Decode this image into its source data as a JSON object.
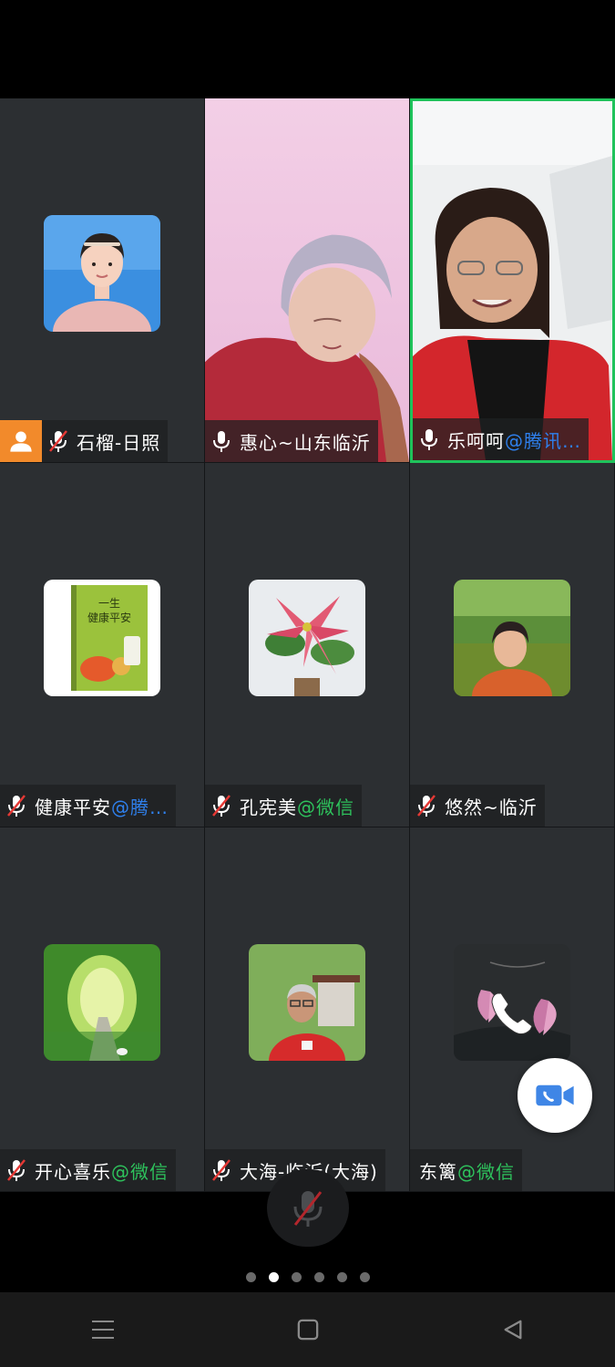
{
  "participants": [
    {
      "name": "石榴-日照",
      "suffix": "",
      "suffix_type": "",
      "mic": "muted",
      "host": true,
      "view": "avatar",
      "avatar": "portrait-blue-bg"
    },
    {
      "name": "惠心~山东临沂",
      "suffix": "",
      "suffix_type": "",
      "mic": "on",
      "host": false,
      "view": "video",
      "avatar": "video-woman-gray-hair"
    },
    {
      "name": "乐呵呵",
      "suffix": "@腾讯…",
      "suffix_type": "tencent",
      "mic": "on",
      "host": false,
      "view": "video",
      "avatar": "video-woman-glasses",
      "active": true
    },
    {
      "name": "健康平安",
      "suffix": "@腾…",
      "suffix_type": "tencent",
      "mic": "muted",
      "host": false,
      "view": "avatar",
      "avatar": "book-cover"
    },
    {
      "name": "孔宪美",
      "suffix": "@微信",
      "suffix_type": "wechat",
      "mic": "muted",
      "host": false,
      "view": "avatar",
      "avatar": "poinsettia-flower"
    },
    {
      "name": "悠然~临沂",
      "suffix": "",
      "suffix_type": "",
      "mic": "muted",
      "host": false,
      "view": "avatar",
      "avatar": "woman-in-park"
    },
    {
      "name": "开心喜乐",
      "suffix": "@微信",
      "suffix_type": "wechat",
      "mic": "muted",
      "host": false,
      "view": "avatar",
      "avatar": "bamboo-path"
    },
    {
      "name": "大海-临沂(大海)",
      "suffix": "",
      "suffix_type": "",
      "mic": "muted",
      "host": false,
      "view": "avatar",
      "avatar": "man-red-shirt"
    },
    {
      "name": "东篱",
      "suffix": "@微信",
      "suffix_type": "wechat",
      "mic": "none",
      "host": false,
      "view": "avatar",
      "avatar": "magnolia-flower"
    }
  ],
  "book_cover": {
    "line1": "一生",
    "line2": "健康平安"
  },
  "pager": {
    "count": 6,
    "current": 1
  },
  "colors": {
    "active_border": "#1fc35b",
    "wechat": "#2ec25c",
    "tencent": "#2f80ed",
    "host_badge": "#f28a2b",
    "tile_bg": "#2c2f32"
  },
  "icons": {
    "mic_float": "mic-muted-icon",
    "call_fab": "video-call-icon",
    "nav": [
      "menu-icon",
      "home-square-icon",
      "back-triangle-icon"
    ]
  }
}
